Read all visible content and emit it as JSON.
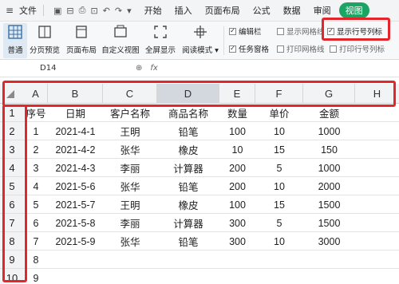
{
  "menubar": {
    "file_label": "文件",
    "tabs": [
      "开始",
      "插入",
      "页面布局",
      "公式",
      "数据",
      "审阅",
      "视图"
    ],
    "active_tab": "视图"
  },
  "ribbon": {
    "buttons": [
      "普通",
      "分页预览",
      "页面布局",
      "自定义视图",
      "全屏显示",
      "阅读模式"
    ],
    "checks": [
      {
        "label": "编辑栏",
        "checked": true
      },
      {
        "label": "显示网格线",
        "checked": false
      },
      {
        "label": "显示行号列标",
        "checked": true
      },
      {
        "label": "任务窗格",
        "checked": true
      },
      {
        "label": "打印网格线",
        "checked": false
      },
      {
        "label": "打印行号列标",
        "checked": false
      }
    ]
  },
  "formula_bar": {
    "name_box": "D14",
    "fx_label": "fx"
  },
  "columns": [
    "A",
    "B",
    "C",
    "D",
    "E",
    "F",
    "G",
    "H"
  ],
  "selected_column": "D",
  "row_numbers": [
    "1",
    "2",
    "3",
    "4",
    "5",
    "6",
    "7",
    "8",
    "9",
    "10"
  ],
  "table": {
    "headers": [
      "序号",
      "日期",
      "客户名称",
      "商品名称",
      "数量",
      "单价",
      "金额"
    ],
    "rows": [
      [
        "1",
        "2021-4-1",
        "王明",
        "铅笔",
        "100",
        "10",
        "1000"
      ],
      [
        "2",
        "2021-4-2",
        "张华",
        "橡皮",
        "10",
        "15",
        "150"
      ],
      [
        "3",
        "2021-4-3",
        "李丽",
        "计算器",
        "200",
        "5",
        "1000"
      ],
      [
        "4",
        "2021-5-6",
        "张华",
        "铅笔",
        "200",
        "10",
        "2000"
      ],
      [
        "5",
        "2021-5-7",
        "王明",
        "橡皮",
        "100",
        "15",
        "1500"
      ],
      [
        "6",
        "2021-5-8",
        "李丽",
        "计算器",
        "300",
        "5",
        "1500"
      ],
      [
        "7",
        "2021-5-9",
        "张华",
        "铅笔",
        "300",
        "10",
        "3000"
      ],
      [
        "8",
        "",
        "",
        "",
        "",
        "",
        ""
      ],
      [
        "9",
        "",
        "",
        "",
        "",
        "",
        ""
      ]
    ]
  },
  "colors": {
    "accent": "#1aa564",
    "highlight": "#e3262b",
    "column_header_bg": "#f2f3f5"
  }
}
